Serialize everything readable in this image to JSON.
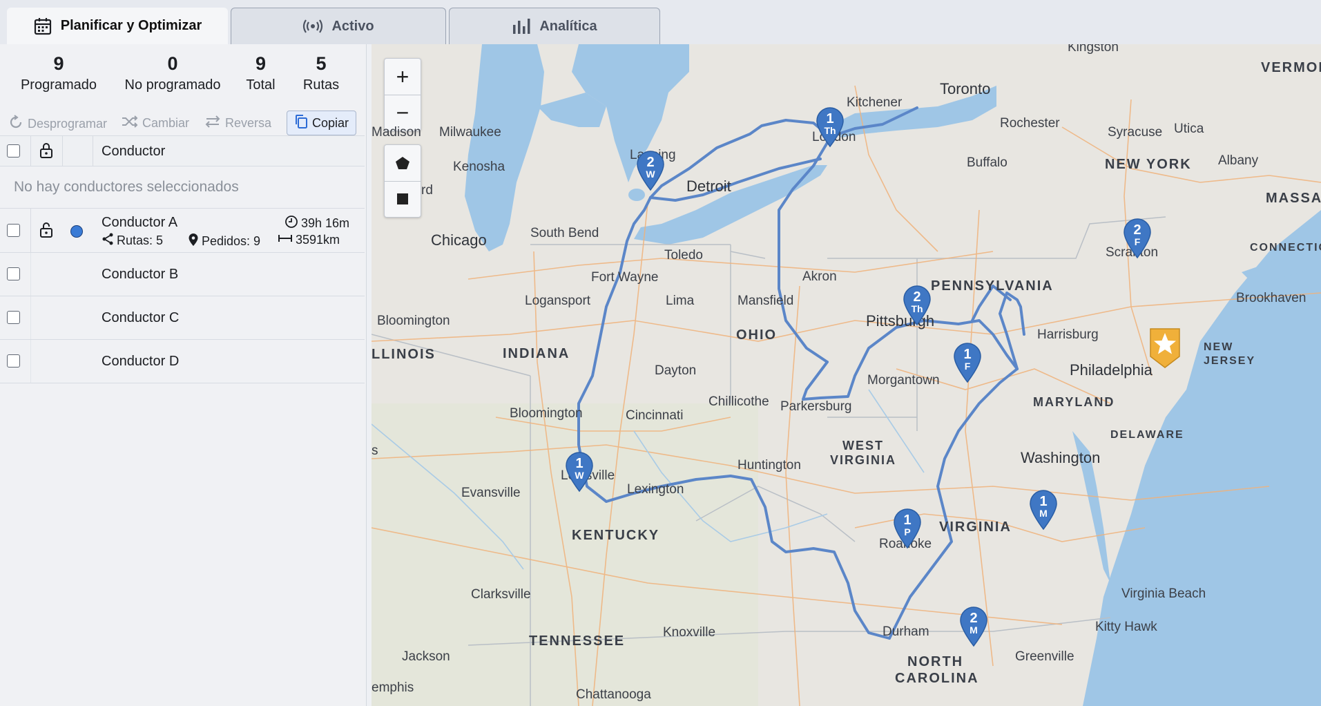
{
  "tabs": [
    {
      "label": "Planificar y Optimizar",
      "icon": "calendar-icon",
      "active": true
    },
    {
      "label": "Activo",
      "icon": "broadcast-icon",
      "active": false
    },
    {
      "label": "Analítica",
      "icon": "bar-chart-icon",
      "active": false
    }
  ],
  "stats": [
    {
      "value": "9",
      "label": "Programado"
    },
    {
      "value": "0",
      "label": "No programado"
    },
    {
      "value": "9",
      "label": "Total"
    },
    {
      "value": "5",
      "label": "Rutas"
    }
  ],
  "actions": {
    "unschedule": "Desprogramar",
    "change": "Cambiar",
    "reverse": "Reversa",
    "copy": "Copiar"
  },
  "table": {
    "header": "Conductor",
    "empty_message": "No hay conductores seleccionados",
    "drivers": [
      {
        "name": "Conductor A",
        "routes": "Rutas: 5",
        "orders": "Pedidos: 9",
        "time": "39h 16m",
        "distance": "3591km",
        "color": "#3a7bd5"
      },
      {
        "name": "Conductor B"
      },
      {
        "name": "Conductor C"
      },
      {
        "name": "Conductor D"
      }
    ]
  },
  "map": {
    "zoom_in": "+",
    "zoom_out": "−",
    "tools": [
      "polygon-tool-icon",
      "rectangle-tool-icon"
    ],
    "route_color": "#5b86c8",
    "pins": [
      {
        "num": "1",
        "day": "Th"
      },
      {
        "num": "2",
        "day": "W"
      },
      {
        "num": "2",
        "day": "F"
      },
      {
        "num": "2",
        "day": "Th"
      },
      {
        "num": "1",
        "day": "F"
      },
      {
        "num": "1",
        "day": "W"
      },
      {
        "num": "1",
        "day": "P"
      },
      {
        "num": "1",
        "day": "M"
      },
      {
        "num": "2",
        "day": "M"
      }
    ],
    "depot_icon": "star-icon",
    "states": [
      "VERMON",
      "NEW YORK",
      "MASSA",
      "CONNECTIC",
      "PENNSYLVANIA",
      "OHIO",
      "INDIANA",
      "LLINOIS",
      "NEW",
      "JERSEY",
      "MARYLAND",
      "DELAWARE",
      "WEST",
      "VIRGINIA",
      "VIRGINIA",
      "KENTUCKY",
      "TENNESSEE",
      "NORTH",
      "CAROLINA"
    ],
    "cities": [
      "Kingston",
      "Toronto",
      "Kitchener",
      "Rochester",
      "Syracuse",
      "Utica",
      "Albany",
      "Milwaukee",
      "Madison",
      "Lansing",
      "Kenosha",
      "Detroit",
      "London",
      "Buffalo",
      "rd",
      "Chicago",
      "South Bend",
      "Toledo",
      "Scranton",
      "Brookhaven",
      "Fort Wayne",
      "Akron",
      "Logansport",
      "Lima",
      "Mansfield",
      "Pittsburgh",
      "Bloomington",
      "Harrisburg",
      "Dayton",
      "Philadelphia",
      "Morgantown",
      "Chillicothe",
      "Parkersburg",
      "Bloomington",
      "Cincinnati",
      "s",
      "Washington",
      "Huntington",
      "Louisville",
      "Evansville",
      "Lexington",
      "Roanoke",
      "Virginia Beach",
      "Clarksville",
      "Kitty Hawk",
      "Knoxville",
      "Durham",
      "Jackson",
      "Greenville",
      "emphis",
      "Chattanooga"
    ]
  }
}
